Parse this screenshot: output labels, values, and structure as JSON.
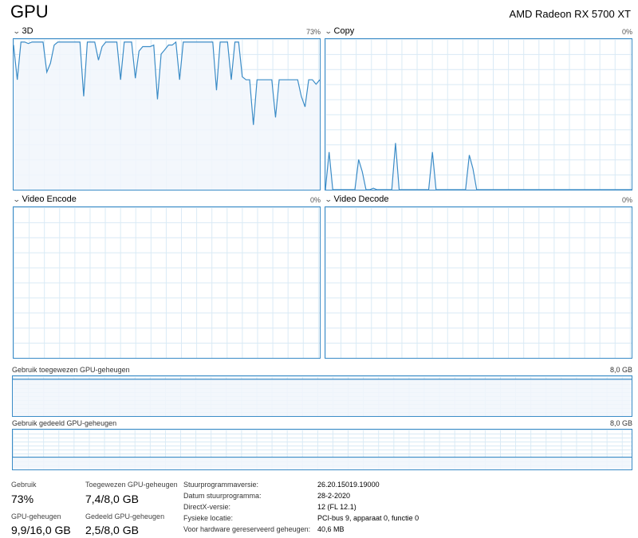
{
  "header": {
    "title": "GPU",
    "device_name": "AMD Radeon RX 5700 XT"
  },
  "engines": [
    {
      "label": "3D",
      "percent": "73%",
      "values": [
        96,
        73,
        98,
        98,
        97,
        98,
        98,
        98,
        98,
        78,
        84,
        96,
        98,
        98,
        98,
        98,
        98,
        98,
        98,
        62,
        98,
        98,
        98,
        86,
        95,
        98,
        98,
        98,
        98,
        73,
        98,
        98,
        98,
        74,
        92,
        95,
        95,
        95,
        96,
        60,
        90,
        93,
        96,
        96,
        98,
        73,
        98,
        98,
        98,
        98,
        98,
        98,
        98,
        98,
        98,
        66,
        98,
        98,
        98,
        73,
        98,
        98,
        75,
        73,
        73,
        43,
        73,
        73,
        73,
        73,
        73,
        48,
        73,
        73,
        73,
        73,
        73,
        73,
        62,
        55,
        73,
        73,
        70,
        73
      ]
    },
    {
      "label": "Copy",
      "percent": "0%",
      "values": [
        0,
        25,
        0,
        0,
        0,
        0,
        0,
        0,
        0,
        20,
        12,
        0,
        0,
        1,
        0,
        0,
        0,
        0,
        0,
        31,
        0,
        0,
        0,
        0,
        0,
        0,
        0,
        0,
        0,
        25,
        0,
        0,
        0,
        0,
        0,
        0,
        0,
        0,
        0,
        23,
        14,
        0,
        0,
        0,
        0,
        0,
        0,
        0,
        0,
        0,
        0,
        0,
        0,
        0,
        0,
        0,
        0,
        0,
        0,
        0,
        0,
        0,
        0,
        0,
        0,
        0,
        0,
        0,
        0,
        0,
        0,
        0,
        0,
        0,
        0,
        0,
        0,
        0,
        0,
        0,
        0,
        0,
        0,
        0
      ]
    },
    {
      "label": "Video Encode",
      "percent": "0%",
      "values": []
    },
    {
      "label": "Video Decode",
      "percent": "0%",
      "values": []
    }
  ],
  "memory": {
    "dedicated": {
      "label": "Gebruik toegewezen GPU-geheugen",
      "max": "8,0 GB",
      "fraction": 0.925
    },
    "shared": {
      "label": "Gebruik gedeeld GPU-geheugen",
      "max": "8,0 GB",
      "fraction": 0.31
    }
  },
  "stats": {
    "usage": {
      "label": "Gebruik",
      "value": "73%"
    },
    "dedicated": {
      "label": "Toegewezen GPU-geheugen",
      "value": "7,4/8,0 GB"
    },
    "gpu_memory": {
      "label": "GPU-geheugen",
      "value": "9,9/16,0 GB"
    },
    "shared": {
      "label": "Gedeeld GPU-geheugen",
      "value": "2,5/8,0 GB"
    }
  },
  "details": [
    {
      "label": "Stuurprogrammaversie:",
      "value": "26.20.15019.19000"
    },
    {
      "label": "Datum stuurprogramma:",
      "value": "28-2-2020"
    },
    {
      "label": "DirectX-versie:",
      "value": "12 (FL 12.1)"
    },
    {
      "label": "Fysieke locatie:",
      "value": "PCI-bus 9, apparaat 0, functie 0"
    },
    {
      "label": "Voor hardware gereserveerd geheugen:",
      "value": "40,6 MB"
    }
  ],
  "colors": {
    "accent": "#3b8cc7",
    "fill": "#f1f6fb",
    "grid": "#d9eaf5"
  }
}
